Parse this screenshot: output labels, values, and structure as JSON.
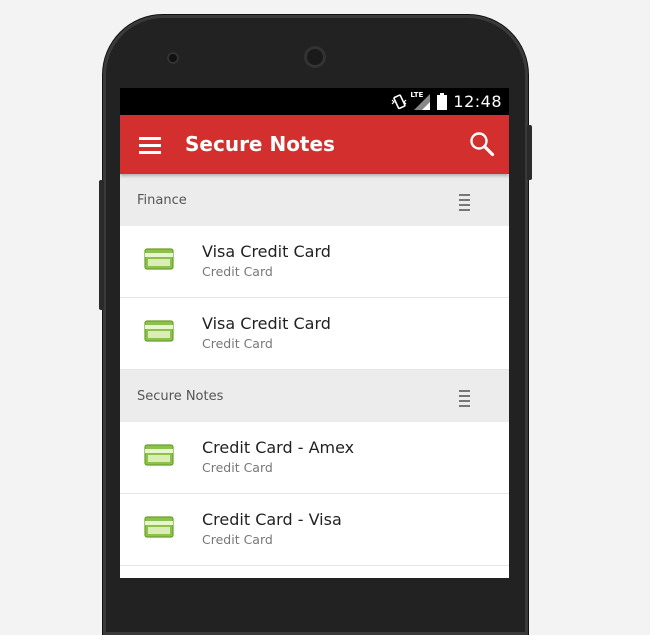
{
  "status_bar": {
    "network_label": "LTE",
    "time": "12:48"
  },
  "app_bar": {
    "title": "Secure Notes",
    "accent_color": "#d32f2f"
  },
  "sections": [
    {
      "title": "Finance",
      "items": [
        {
          "title": "Visa Credit Card",
          "subtitle": "Credit Card",
          "icon": "credit-card-icon"
        },
        {
          "title": "Visa Credit Card",
          "subtitle": "Credit Card",
          "icon": "credit-card-icon"
        }
      ]
    },
    {
      "title": "Secure Notes",
      "items": [
        {
          "title": "Credit Card - Amex",
          "subtitle": "Credit Card",
          "icon": "credit-card-icon"
        },
        {
          "title": "Credit Card - Visa",
          "subtitle": "Credit Card",
          "icon": "credit-card-icon"
        }
      ]
    }
  ],
  "icon_color": "#7cb342"
}
